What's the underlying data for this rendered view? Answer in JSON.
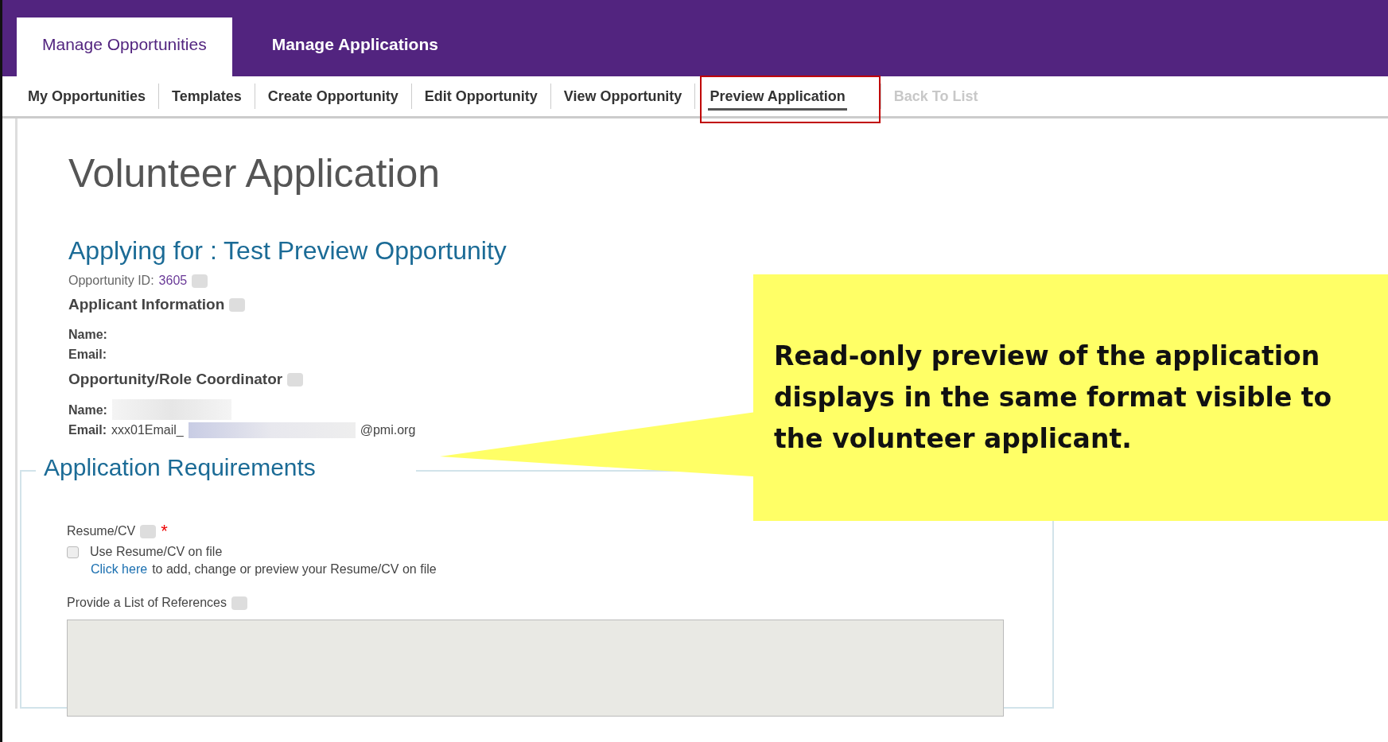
{
  "tabs": [
    {
      "label": "Manage Opportunities",
      "selected": true
    },
    {
      "label": "Manage Applications",
      "selected": false
    }
  ],
  "subnav": [
    {
      "label": "My Opportunities",
      "selected": false,
      "disabled": false
    },
    {
      "label": "Templates",
      "selected": false,
      "disabled": false
    },
    {
      "label": "Create Opportunity",
      "selected": false,
      "disabled": false
    },
    {
      "label": "Edit Opportunity",
      "selected": false,
      "disabled": false
    },
    {
      "label": "View Opportunity",
      "selected": false,
      "disabled": false
    },
    {
      "label": "Preview Application",
      "selected": true,
      "disabled": false
    },
    {
      "label": "Back To List",
      "selected": false,
      "disabled": true
    }
  ],
  "page_title": "Volunteer Application",
  "applying_for": "Applying for : Test Preview Opportunity",
  "opportunity_id": {
    "label": "Opportunity ID:",
    "value": "3605"
  },
  "applicant": {
    "heading": "Applicant Information",
    "name_label": "Name:",
    "email_label": "Email:"
  },
  "coordinator": {
    "heading": "Opportunity/Role Coordinator",
    "name_label": "Name:",
    "email_label": "Email:",
    "email_start": "xxx01Email_",
    "email_end": "@pmi.org"
  },
  "requirements": {
    "legend": "Application Requirements",
    "resume_label": "Resume/CV",
    "required_mark": "*",
    "checkbox": {
      "label": "Use Resume/CV on file",
      "checked": false
    },
    "link": "Click here",
    "link_rest": "to add, change or preview your Resume/CV on file",
    "references_label": "Provide a List of References"
  },
  "callout": "Read-only preview of the application displays in the same format visible to the volunteer applicant."
}
